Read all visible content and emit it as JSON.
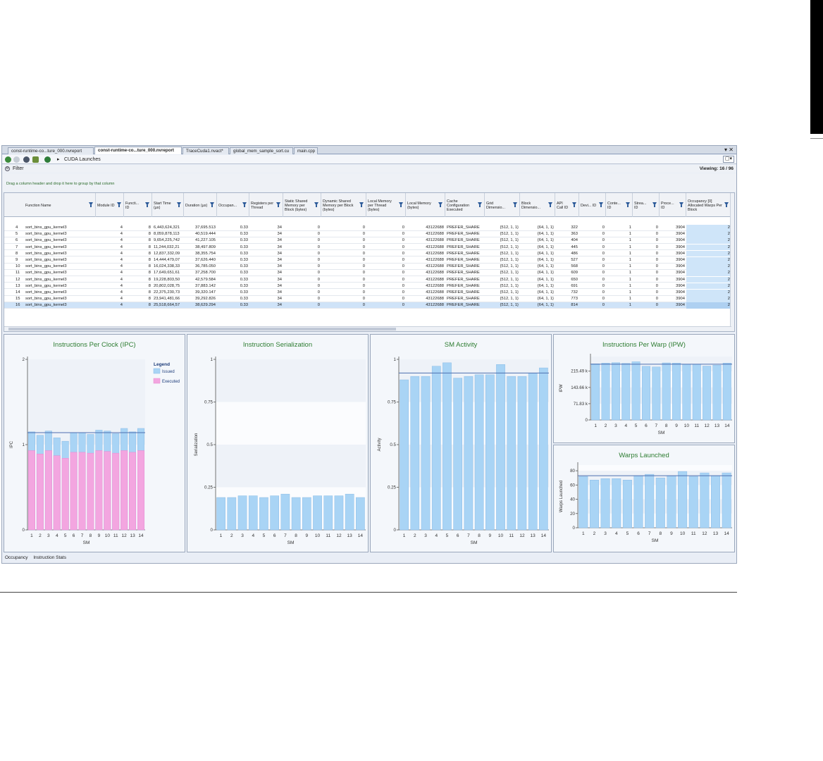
{
  "tabs": [
    {
      "label": "const-runtime-co...ture_000.nvreport",
      "active": false
    },
    {
      "label": "const-runtime-co...ture_000.nvreport",
      "active": true
    },
    {
      "label": "TraceCuda1.nvact*",
      "active": false
    },
    {
      "label": "global_mem_sample_sort.cu",
      "active": false
    },
    {
      "label": "main.cpp",
      "active": false
    }
  ],
  "tab_controls": "▾ ✕",
  "nav": {
    "title": "CUDA Launches",
    "menu_glyph": "▢▾",
    "separator": "▸"
  },
  "filter": {
    "label": "Filter",
    "toggle": "⊝",
    "viewing": "Viewing: 16 / 96"
  },
  "group_hint": "Drag a column header and drop it here to group by that column",
  "columns": [
    "Function Name",
    "Module ID",
    "Functi... ID",
    "Start Time (µs)",
    "Duration (µs)",
    "Occupan...",
    "Registers per Thread",
    "Static Shared Memory per Block (bytes)",
    "Dynamic Shared Memory per Block (bytes)",
    "Local Memory per Thread (bytes)",
    "Local Memory (bytes)",
    "Cache Configuration Executed",
    "Grid Dimensio...",
    "Block Dimensio...",
    "API Call ID",
    "Devi... ID",
    "Conte... ID",
    "Strea... ID",
    "Proce... ID",
    "Occupancy [0] Allocated Warps Per Block"
  ],
  "rows": [
    {
      "idx": "4",
      "name": "sort_bins_gpu_kernel3",
      "module": "4",
      "func": "8",
      "start": "6,443,624,321",
      "dur": "37,695.513",
      "occ": "0.33",
      "regs": "34",
      "ssm": "0",
      "dsm": "0",
      "lmt": "0",
      "lm": "43122688",
      "cache": "PREFER_SHARE",
      "grid": "{512, 1, 1}",
      "block": "{64, 1, 1}",
      "api": "322",
      "dev": "0",
      "ctx": "1",
      "strm": "0",
      "proc": "3904",
      "occw": "2"
    },
    {
      "idx": "5",
      "name": "sort_bins_gpu_kernel3",
      "module": "4",
      "func": "8",
      "start": "8,059,878,113",
      "dur": "40,519.444",
      "occ": "0.33",
      "regs": "34",
      "ssm": "0",
      "dsm": "0",
      "lmt": "0",
      "lm": "43122688",
      "cache": "PREFER_SHARE",
      "grid": "{512, 1, 1}",
      "block": "{64, 1, 1}",
      "api": "363",
      "dev": "0",
      "ctx": "1",
      "strm": "0",
      "proc": "3904",
      "occw": "2"
    },
    {
      "idx": "6",
      "name": "sort_bins_gpu_kernel3",
      "module": "4",
      "func": "8",
      "start": "9,654,225,742",
      "dur": "41,227.105",
      "occ": "0.33",
      "regs": "34",
      "ssm": "0",
      "dsm": "0",
      "lmt": "0",
      "lm": "43122688",
      "cache": "PREFER_SHARE",
      "grid": "{512, 1, 1}",
      "block": "{64, 1, 1}",
      "api": "404",
      "dev": "0",
      "ctx": "1",
      "strm": "0",
      "proc": "3904",
      "occw": "2"
    },
    {
      "idx": "7",
      "name": "sort_bins_gpu_kernel3",
      "module": "4",
      "func": "8",
      "start": "11,244,032,21",
      "dur": "38,497.809",
      "occ": "0.33",
      "regs": "34",
      "ssm": "0",
      "dsm": "0",
      "lmt": "0",
      "lm": "43122688",
      "cache": "PREFER_SHARE",
      "grid": "{512, 1, 1}",
      "block": "{64, 1, 1}",
      "api": "445",
      "dev": "0",
      "ctx": "1",
      "strm": "0",
      "proc": "3904",
      "occw": "2"
    },
    {
      "idx": "8",
      "name": "sort_bins_gpu_kernel3",
      "module": "4",
      "func": "8",
      "start": "12,837,332,09",
      "dur": "38,355.754",
      "occ": "0.33",
      "regs": "34",
      "ssm": "0",
      "dsm": "0",
      "lmt": "0",
      "lm": "43122688",
      "cache": "PREFER_SHARE",
      "grid": "{512, 1, 1}",
      "block": "{64, 1, 1}",
      "api": "486",
      "dev": "0",
      "ctx": "1",
      "strm": "0",
      "proc": "3904",
      "occw": "2"
    },
    {
      "idx": "9",
      "name": "sort_bins_gpu_kernel3",
      "module": "4",
      "func": "8",
      "start": "14,444,479,07",
      "dur": "37,626.440",
      "occ": "0.33",
      "regs": "34",
      "ssm": "0",
      "dsm": "0",
      "lmt": "0",
      "lm": "43122688",
      "cache": "PREFER_SHARE",
      "grid": "{512, 1, 1}",
      "block": "{64, 1, 1}",
      "api": "527",
      "dev": "0",
      "ctx": "1",
      "strm": "0",
      "proc": "3904",
      "occw": "2"
    },
    {
      "idx": "10",
      "name": "sort_bins_gpu_kernel3",
      "module": "4",
      "func": "8",
      "start": "16,024,338,33",
      "dur": "36,785.050",
      "occ": "0.33",
      "regs": "34",
      "ssm": "0",
      "dsm": "0",
      "lmt": "0",
      "lm": "43122688",
      "cache": "PREFER_SHARE",
      "grid": "{512, 1, 1}",
      "block": "{64, 1, 1}",
      "api": "568",
      "dev": "0",
      "ctx": "1",
      "strm": "0",
      "proc": "3904",
      "occw": "2"
    },
    {
      "idx": "11",
      "name": "sort_bins_gpu_kernel3",
      "module": "4",
      "func": "8",
      "start": "17,649,651,61",
      "dur": "37,258.700",
      "occ": "0.33",
      "regs": "34",
      "ssm": "0",
      "dsm": "0",
      "lmt": "0",
      "lm": "43122688",
      "cache": "PREFER_SHARE",
      "grid": "{512, 1, 1}",
      "block": "{64, 1, 1}",
      "api": "609",
      "dev": "0",
      "ctx": "1",
      "strm": "0",
      "proc": "3904",
      "occw": "2"
    },
    {
      "idx": "12",
      "name": "sort_bins_gpu_kernel3",
      "module": "4",
      "func": "8",
      "start": "19,228,803,50",
      "dur": "42,579.584",
      "occ": "0.33",
      "regs": "34",
      "ssm": "0",
      "dsm": "0",
      "lmt": "0",
      "lm": "43122688",
      "cache": "PREFER_SHARE",
      "grid": "{512, 1, 1}",
      "block": "{64, 1, 1}",
      "api": "650",
      "dev": "0",
      "ctx": "1",
      "strm": "0",
      "proc": "3904",
      "occw": "2"
    },
    {
      "idx": "13",
      "name": "sort_bins_gpu_kernel3",
      "module": "4",
      "func": "8",
      "start": "20,802,028,75",
      "dur": "37,883.142",
      "occ": "0.33",
      "regs": "34",
      "ssm": "0",
      "dsm": "0",
      "lmt": "0",
      "lm": "43122688",
      "cache": "PREFER_SHARE",
      "grid": "{512, 1, 1}",
      "block": "{64, 1, 1}",
      "api": "691",
      "dev": "0",
      "ctx": "1",
      "strm": "0",
      "proc": "3904",
      "occw": "2"
    },
    {
      "idx": "14",
      "name": "sort_bins_gpu_kernel3",
      "module": "4",
      "func": "8",
      "start": "22,375,230,73",
      "dur": "39,320.147",
      "occ": "0.33",
      "regs": "34",
      "ssm": "0",
      "dsm": "0",
      "lmt": "0",
      "lm": "43122688",
      "cache": "PREFER_SHARE",
      "grid": "{512, 1, 1}",
      "block": "{64, 1, 1}",
      "api": "732",
      "dev": "0",
      "ctx": "1",
      "strm": "0",
      "proc": "3904",
      "occw": "2"
    },
    {
      "idx": "15",
      "name": "sort_bins_gpu_kernel3",
      "module": "4",
      "func": "8",
      "start": "23,941,481,66",
      "dur": "39,292.826",
      "occ": "0.33",
      "regs": "34",
      "ssm": "0",
      "dsm": "0",
      "lmt": "0",
      "lm": "43122688",
      "cache": "PREFER_SHARE",
      "grid": "{512, 1, 1}",
      "block": "{64, 1, 1}",
      "api": "773",
      "dev": "0",
      "ctx": "1",
      "strm": "0",
      "proc": "3904",
      "occw": "2"
    },
    {
      "idx": "16",
      "name": "sort_bins_gpu_kernel3",
      "module": "4",
      "func": "8",
      "start": "25,518,664,57",
      "dur": "38,629.294",
      "occ": "0.33",
      "regs": "34",
      "ssm": "0",
      "dsm": "0",
      "lmt": "0",
      "lm": "43122688",
      "cache": "PREFER_SHARE",
      "grid": "{512, 1, 1}",
      "block": "{64, 1, 1}",
      "api": "814",
      "dev": "0",
      "ctx": "1",
      "strm": "0",
      "proc": "3904",
      "occw": "2",
      "selected": true
    }
  ],
  "bottom_tabs": [
    "Occupancy",
    "Instruction Stats"
  ],
  "colors": {
    "bar_blue": "#a9d4f5",
    "bar_pink": "#f3a6e0",
    "title_green": "#2e7d32",
    "avg_line": "#4d6fb0"
  },
  "chart_data": [
    {
      "type": "bar",
      "title": "Instructions Per Clock (IPC)",
      "xlabel": "SM",
      "ylabel": "IPC",
      "categories": [
        "1",
        "2",
        "3",
        "4",
        "5",
        "6",
        "7",
        "8",
        "9",
        "10",
        "11",
        "12",
        "13",
        "14"
      ],
      "ylim": [
        0,
        2
      ],
      "yticks": [
        "0",
        "1",
        "2"
      ],
      "legend_title": "Legend",
      "legend_position": "top-right",
      "series": [
        {
          "name": "Issued",
          "values": [
            1.15,
            1.11,
            1.16,
            1.08,
            1.04,
            1.14,
            1.14,
            1.12,
            1.17,
            1.16,
            1.13,
            1.19,
            1.15,
            1.19
          ]
        },
        {
          "name": "Executed",
          "values": [
            0.93,
            0.89,
            0.93,
            0.87,
            0.84,
            0.91,
            0.91,
            0.9,
            0.93,
            0.92,
            0.9,
            0.93,
            0.91,
            0.93
          ]
        }
      ],
      "average": 1.14
    },
    {
      "type": "bar",
      "title": "Instruction Serialization",
      "xlabel": "SM",
      "ylabel": "Serialization",
      "categories": [
        "1",
        "2",
        "3",
        "4",
        "5",
        "6",
        "7",
        "8",
        "9",
        "10",
        "11",
        "12",
        "13",
        "14"
      ],
      "ylim": [
        0,
        1
      ],
      "yticks": [
        "0",
        "0.25",
        "0.5",
        "0.75",
        "1"
      ],
      "values": [
        0.19,
        0.19,
        0.2,
        0.2,
        0.19,
        0.2,
        0.21,
        0.19,
        0.19,
        0.2,
        0.2,
        0.2,
        0.21,
        0.19
      ]
    },
    {
      "type": "bar",
      "title": "SM Activity",
      "xlabel": "SM",
      "ylabel": "Activity",
      "categories": [
        "1",
        "2",
        "3",
        "4",
        "5",
        "6",
        "7",
        "8",
        "9",
        "10",
        "11",
        "12",
        "13",
        "14"
      ],
      "ylim": [
        0,
        1
      ],
      "yticks": [
        "0",
        "0.25",
        "0.5",
        "0.75",
        "1"
      ],
      "values": [
        0.88,
        0.9,
        0.9,
        0.96,
        0.98,
        0.89,
        0.9,
        0.91,
        0.91,
        0.97,
        0.9,
        0.9,
        0.92,
        0.95
      ],
      "average": 0.92
    },
    {
      "type": "bar",
      "title": "Instructions Per Warp (IPW)",
      "xlabel": "SM",
      "ylabel": "IPW",
      "categories": [
        "1",
        "2",
        "3",
        "4",
        "5",
        "6",
        "7",
        "8",
        "9",
        "10",
        "11",
        "12",
        "13",
        "14"
      ],
      "ylim": [
        0,
        280000
      ],
      "yticks": [
        "0",
        "71.83 k",
        "143.66 k",
        "215.49 k"
      ],
      "values": [
        248000,
        251000,
        253000,
        250000,
        257000,
        237000,
        234000,
        252000,
        251000,
        246000,
        246000,
        238000,
        242000,
        251000
      ],
      "average": 246000
    },
    {
      "type": "bar",
      "title": "Warps Launched",
      "xlabel": "SM",
      "ylabel": "Warps Launched",
      "categories": [
        "1",
        "2",
        "3",
        "4",
        "5",
        "6",
        "7",
        "8",
        "9",
        "10",
        "11",
        "12",
        "13",
        "14"
      ],
      "ylim": [
        0,
        88
      ],
      "yticks": [
        "0",
        "20",
        "40",
        "60",
        "80"
      ],
      "values": [
        72,
        67,
        69,
        69,
        67,
        73,
        75,
        70,
        73,
        79,
        72,
        77,
        73,
        77
      ],
      "average": 73
    }
  ]
}
